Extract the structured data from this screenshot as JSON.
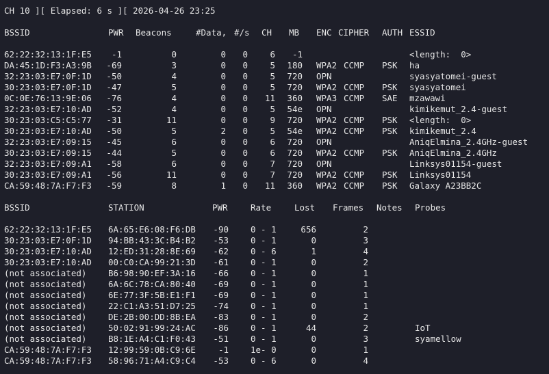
{
  "status_line": "CH 10 ][ Elapsed: 6 s ][ 2026-04-26 23:25",
  "ap_table": {
    "headers": {
      "bssid": "BSSID",
      "pwr": "PWR",
      "beacons": "Beacons",
      "data": "#Data,",
      "per_sec": "#/s",
      "ch": "CH",
      "mb": "MB",
      "enc": "ENC",
      "cipher": "CIPHER",
      "auth": "AUTH",
      "essid": "ESSID"
    },
    "rows": [
      {
        "bssid": "62:22:32:13:1F:E5",
        "pwr": "-1",
        "beacons": "0",
        "data": "0",
        "per_sec": "0",
        "ch": "6",
        "mb": "-1",
        "enc": "",
        "cipher": "",
        "auth": "",
        "essid": "<length:  0>"
      },
      {
        "bssid": "DA:45:1D:F3:A3:9B",
        "pwr": "-69",
        "beacons": "3",
        "data": "0",
        "per_sec": "0",
        "ch": "5",
        "mb": "180",
        "enc": "WPA2",
        "cipher": "CCMP",
        "auth": "PSK",
        "essid": "ha"
      },
      {
        "bssid": "32:23:03:E7:0F:1D",
        "pwr": "-50",
        "beacons": "4",
        "data": "0",
        "per_sec": "0",
        "ch": "5",
        "mb": "720",
        "enc": "OPN",
        "cipher": "",
        "auth": "",
        "essid": "syasyatomei-guest"
      },
      {
        "bssid": "30:23:03:E7:0F:1D",
        "pwr": "-47",
        "beacons": "5",
        "data": "0",
        "per_sec": "0",
        "ch": "5",
        "mb": "720",
        "enc": "WPA2",
        "cipher": "CCMP",
        "auth": "PSK",
        "essid": "syasyatomei"
      },
      {
        "bssid": "0C:0E:76:13:9E:06",
        "pwr": "-76",
        "beacons": "4",
        "data": "0",
        "per_sec": "0",
        "ch": "11",
        "mb": "360",
        "enc": "WPA3",
        "cipher": "CCMP",
        "auth": "SAE",
        "essid": "mzawawi"
      },
      {
        "bssid": "32:23:03:E7:10:AD",
        "pwr": "-52",
        "beacons": "4",
        "data": "0",
        "per_sec": "0",
        "ch": "5",
        "mb": "54e",
        "enc": "OPN",
        "cipher": "",
        "auth": "",
        "essid": "kimikemut_2.4-guest"
      },
      {
        "bssid": "30:23:03:C5:C5:77",
        "pwr": "-31",
        "beacons": "11",
        "data": "0",
        "per_sec": "0",
        "ch": "9",
        "mb": "720",
        "enc": "WPA2",
        "cipher": "CCMP",
        "auth": "PSK",
        "essid": "<length:  0>"
      },
      {
        "bssid": "30:23:03:E7:10:AD",
        "pwr": "-50",
        "beacons": "5",
        "data": "2",
        "per_sec": "0",
        "ch": "5",
        "mb": "54e",
        "enc": "WPA2",
        "cipher": "CCMP",
        "auth": "PSK",
        "essid": "kimikemut_2.4"
      },
      {
        "bssid": "32:23:03:E7:09:15",
        "pwr": "-45",
        "beacons": "6",
        "data": "0",
        "per_sec": "0",
        "ch": "6",
        "mb": "720",
        "enc": "OPN",
        "cipher": "",
        "auth": "",
        "essid": "AniqElmina_2.4GHz-guest"
      },
      {
        "bssid": "30:23:03:E7:09:15",
        "pwr": "-44",
        "beacons": "5",
        "data": "0",
        "per_sec": "0",
        "ch": "6",
        "mb": "720",
        "enc": "WPA2",
        "cipher": "CCMP",
        "auth": "PSK",
        "essid": "AniqElmina_2.4GHz"
      },
      {
        "bssid": "32:23:03:E7:09:A1",
        "pwr": "-58",
        "beacons": "6",
        "data": "0",
        "per_sec": "0",
        "ch": "7",
        "mb": "720",
        "enc": "OPN",
        "cipher": "",
        "auth": "",
        "essid": "Linksys01154-guest"
      },
      {
        "bssid": "30:23:03:E7:09:A1",
        "pwr": "-56",
        "beacons": "11",
        "data": "0",
        "per_sec": "0",
        "ch": "7",
        "mb": "720",
        "enc": "WPA2",
        "cipher": "CCMP",
        "auth": "PSK",
        "essid": "Linksys01154"
      },
      {
        "bssid": "CA:59:48:7A:F7:F3",
        "pwr": "-59",
        "beacons": "8",
        "data": "1",
        "per_sec": "0",
        "ch": "11",
        "mb": "360",
        "enc": "WPA2",
        "cipher": "CCMP",
        "auth": "PSK",
        "essid": "Galaxy A23BB2C"
      }
    ]
  },
  "station_table": {
    "headers": {
      "bssid": "BSSID",
      "station": "STATION",
      "pwr": "PWR",
      "rate": "Rate",
      "lost": "Lost",
      "frames": "Frames",
      "notes": "Notes",
      "probes": "Probes"
    },
    "rows": [
      {
        "bssid": "62:22:32:13:1F:E5",
        "station": "6A:65:E6:08:F6:DB",
        "pwr": "-90",
        "rate": "0 - 1",
        "lost": "656",
        "frames": "2",
        "notes": "",
        "probes": ""
      },
      {
        "bssid": "30:23:03:E7:0F:1D",
        "station": "94:BB:43:3C:B4:B2",
        "pwr": "-53",
        "rate": "0 - 1",
        "lost": "0",
        "frames": "3",
        "notes": "",
        "probes": ""
      },
      {
        "bssid": "30:23:03:E7:10:AD",
        "station": "12:ED:31:28:8E:69",
        "pwr": "-62",
        "rate": "0 - 6",
        "lost": "1",
        "frames": "4",
        "notes": "",
        "probes": ""
      },
      {
        "bssid": "30:23:03:E7:10:AD",
        "station": "00:C0:CA:99:21:3D",
        "pwr": "-61",
        "rate": "0 - 1",
        "lost": "0",
        "frames": "2",
        "notes": "",
        "probes": ""
      },
      {
        "bssid": "(not associated)",
        "station": "B6:98:90:EF:3A:16",
        "pwr": "-66",
        "rate": "0 - 1",
        "lost": "0",
        "frames": "1",
        "notes": "",
        "probes": ""
      },
      {
        "bssid": "(not associated)",
        "station": "6A:6C:78:CA:80:40",
        "pwr": "-69",
        "rate": "0 - 1",
        "lost": "0",
        "frames": "1",
        "notes": "",
        "probes": ""
      },
      {
        "bssid": "(not associated)",
        "station": "6E:77:3F:5B:E1:F1",
        "pwr": "-69",
        "rate": "0 - 1",
        "lost": "0",
        "frames": "1",
        "notes": "",
        "probes": ""
      },
      {
        "bssid": "(not associated)",
        "station": "22:C1:A3:51:D7:25",
        "pwr": "-74",
        "rate": "0 - 1",
        "lost": "0",
        "frames": "1",
        "notes": "",
        "probes": ""
      },
      {
        "bssid": "(not associated)",
        "station": "DE:2B:00:DD:8B:EA",
        "pwr": "-83",
        "rate": "0 - 1",
        "lost": "0",
        "frames": "2",
        "notes": "",
        "probes": ""
      },
      {
        "bssid": "(not associated)",
        "station": "50:02:91:99:24:AC",
        "pwr": "-86",
        "rate": "0 - 1",
        "lost": "44",
        "frames": "2",
        "notes": "",
        "probes": "IoT"
      },
      {
        "bssid": "(not associated)",
        "station": "B8:1E:A4:C1:F0:43",
        "pwr": "-51",
        "rate": "0 - 1",
        "lost": "0",
        "frames": "3",
        "notes": "",
        "probes": "syamellow"
      },
      {
        "bssid": "CA:59:48:7A:F7:F3",
        "station": "12:99:59:0B:C9:6E",
        "pwr": "-1",
        "rate": "1e- 0",
        "lost": "0",
        "frames": "1",
        "notes": "",
        "probes": ""
      },
      {
        "bssid": "CA:59:48:7A:F7:F3",
        "station": "58:96:71:A4:C9:C4",
        "pwr": "-53",
        "rate": "0 - 6",
        "lost": "0",
        "frames": "4",
        "notes": "",
        "probes": ""
      }
    ]
  },
  "colors": {
    "background": "#1e1f29",
    "foreground": "#e6e6e6"
  }
}
